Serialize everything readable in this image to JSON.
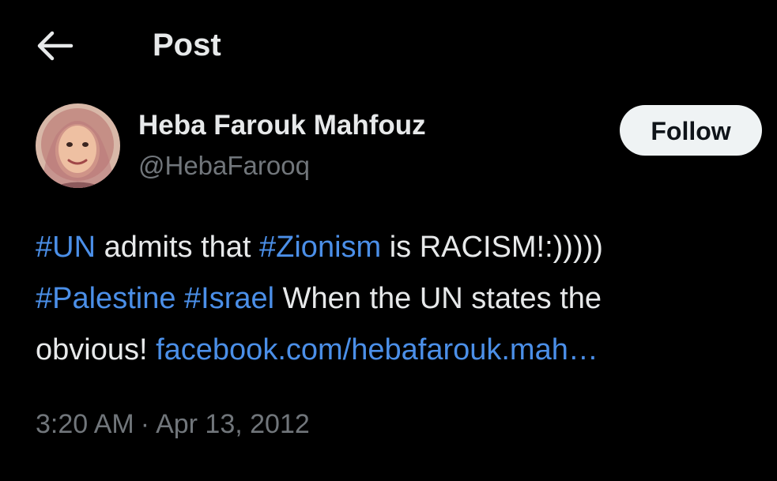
{
  "header": {
    "title": "Post",
    "back_icon": "arrow-left-icon"
  },
  "author": {
    "display_name": "Heba Farouk Mahfouz",
    "handle": "@HebaFarooq",
    "avatar_icon": "profile-photo"
  },
  "follow_button": {
    "label": "Follow"
  },
  "tweet": {
    "line1": {
      "tag1": "#UN",
      "text1": " admits that ",
      "tag2": "#Zionism",
      "text2": " is RACISM!:)))))"
    },
    "line2": {
      "tag1": "#Palestine",
      "space": " ",
      "tag2": "#Israel",
      "text": " When the UN states the"
    },
    "line3": {
      "text": "obvious! ",
      "link": "facebook.com/hebafarouk.mah…"
    }
  },
  "meta": {
    "time": "3:20 AM",
    "separator": "·",
    "date": "Apr 13, 2012"
  },
  "colors": {
    "background": "#000000",
    "text": "#e7e9ea",
    "secondary": "#71767b",
    "link": "#4b8fe8",
    "follow_bg": "#eff3f4"
  }
}
